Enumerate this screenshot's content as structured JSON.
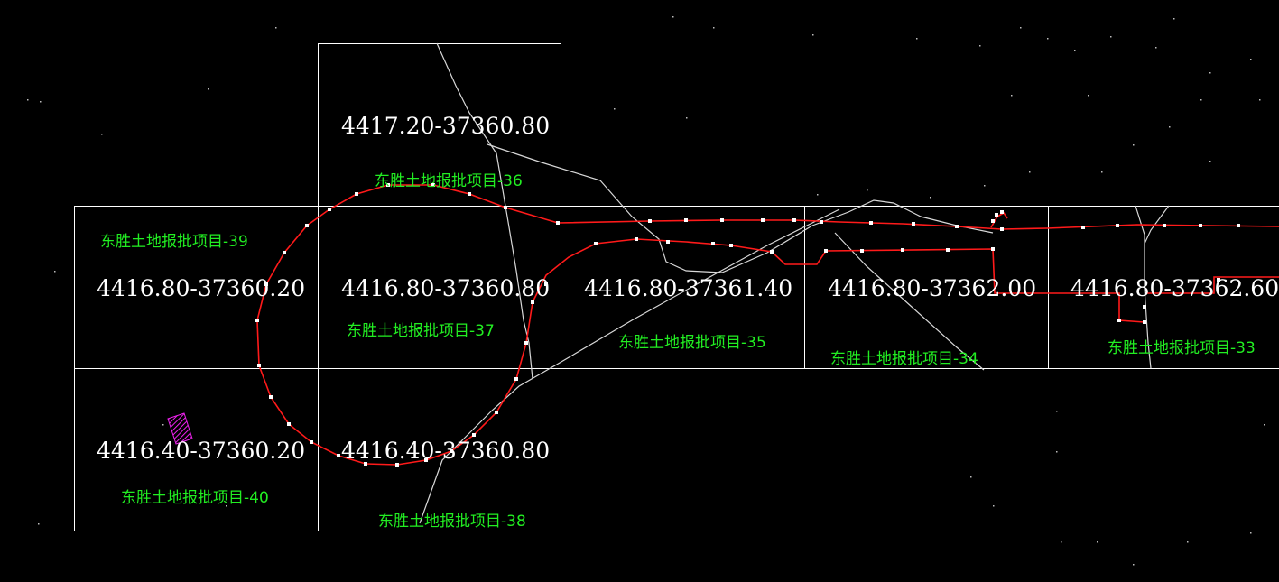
{
  "canvas": {
    "background": "#000000"
  },
  "colors": {
    "tile_border": "#ffffff",
    "coord_text": "#ffffff",
    "project_text": "#22ee22",
    "boundary": "#ff1a1a",
    "road": "#d8d8d8",
    "hatch": "#ee22ee"
  },
  "tiles": [
    {
      "id": "t36",
      "coord": "4417.20-37360.80",
      "project": "东胜土地报批项目-36"
    },
    {
      "id": "t39",
      "coord": "4416.80-37360.20",
      "project": "东胜土地报批项目-39"
    },
    {
      "id": "t37",
      "coord": "4416.80-37360.80",
      "project": "东胜土地报批项目-37"
    },
    {
      "id": "t35",
      "coord": "4416.80-37361.40",
      "project": "东胜土地报批项目-35"
    },
    {
      "id": "t34",
      "coord": "4416.80-37362.00",
      "project": "东胜土地报批项目-34"
    },
    {
      "id": "t33",
      "coord": "4416.80-37362.60",
      "project": "东胜土地报批项目-33"
    },
    {
      "id": "t40",
      "coord": "4416.40-37360.20",
      "project": "东胜土地报批项目-40"
    },
    {
      "id": "t38",
      "coord": "4416.40-37360.80",
      "project": "东胜土地报批项目-38"
    }
  ]
}
